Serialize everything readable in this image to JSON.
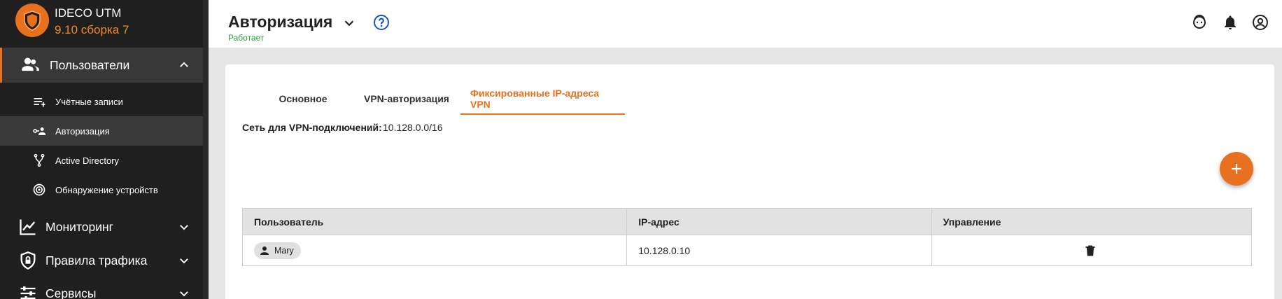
{
  "brand": {
    "title": "IDECO UTM",
    "version": "9.10 сборка 7"
  },
  "sidebar": {
    "items": [
      {
        "label": "Пользователи",
        "icon": "users-icon",
        "expanded": true
      },
      {
        "label": "Учётные записи",
        "icon": "list-icon"
      },
      {
        "label": "Авторизация",
        "icon": "user-key-icon",
        "active": true
      },
      {
        "label": "Active Directory",
        "icon": "fork-icon"
      },
      {
        "label": "Обнаружение устройств",
        "icon": "radar-icon"
      },
      {
        "label": "Мониторинг",
        "icon": "chart-icon",
        "expanded": false
      },
      {
        "label": "Правила трафика",
        "icon": "shield-lock-icon",
        "expanded": false
      },
      {
        "label": "Сервисы",
        "icon": "sliders-icon",
        "expanded": false
      }
    ]
  },
  "header": {
    "title": "Авторизация",
    "status": "Работает"
  },
  "tabs": [
    {
      "label": "Основное"
    },
    {
      "label": "VPN-авторизация"
    },
    {
      "label": "Фиксированные IP-адреса VPN",
      "active": true
    }
  ],
  "network": {
    "label": "Сеть для VPN-подключений:",
    "value": "10.128.0.0/16"
  },
  "table": {
    "headers": [
      "Пользователь",
      "IP-адрес",
      "Управление"
    ],
    "rows": [
      {
        "user": "Mary",
        "ip": "10.128.0.10"
      }
    ]
  },
  "colors": {
    "accent": "#e8711f",
    "sidebar_bg": "#1f1f1f",
    "status_ok": "#2e9e3a",
    "help_blue": "#1a4fd6"
  }
}
